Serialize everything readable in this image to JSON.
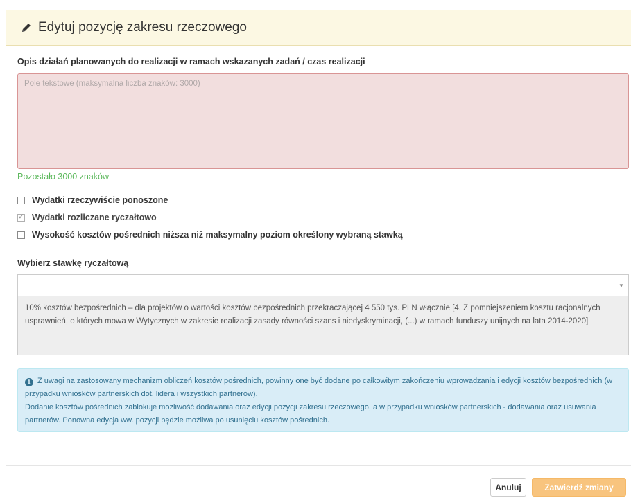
{
  "window_controls": "...",
  "header": {
    "title": "Edytuj pozycję zakresu rzeczowego",
    "icon": "pencil-icon",
    "background": "#fcf8e3"
  },
  "description_field": {
    "label": "Opis działań planowanych do realizacji w ramach wskazanych zadań / czas realizacji",
    "value": "",
    "placeholder": "Pole tekstowe (maksymalna liczba znaków: 3000)",
    "remaining": "Pozostało 3000 znaków"
  },
  "checkboxes": [
    {
      "label": "Wydatki rzeczywiście ponoszone",
      "checked": false
    },
    {
      "label": "Wydatki rozliczane ryczałtowo",
      "checked": true,
      "disabled": true
    },
    {
      "label": "Wysokość kosztów pośrednich niższa niż maksymalny poziom określony wybraną stawką",
      "checked": false
    }
  ],
  "rate_select": {
    "label": "Wybierz stawkę ryczałtową",
    "selected": "",
    "description": "10% kosztów bezpośrednich – dla projektów o wartości kosztów bezpośrednich przekraczającej 4 550 tys. PLN włącznie [4. Z pomniejszeniem kosztu racjonalnych usprawnień, o których mowa w Wytycznych w zakresie realizacji zasady równości szans i niedyskryminacji, (...) w ramach funduszy unijnych na lata 2014-2020]"
  },
  "info": {
    "line1": "Z uwagi na zastosowany mechanizm obliczeń kosztów pośrednich, powinny one być dodane po całkowitym zakończeniu wprowadzania i edycji kosztów bezpośrednich (w przypadku wniosków partnerskich dot. lidera i wszystkich partnerów).",
    "line2": "Dodanie kosztów pośrednich zablokuje możliwość dodawania oraz edycji pozycji zakresu rzeczowego, a w przypadku wniosków partnerskich - dodawania oraz usuwania partnerów. Ponowna edycja ww. pozycji będzie możliwa po usunięciu kosztów pośrednich."
  },
  "footer": {
    "cancel_label": "Anuluj",
    "confirm_label": "Zatwierdź zmiany"
  }
}
